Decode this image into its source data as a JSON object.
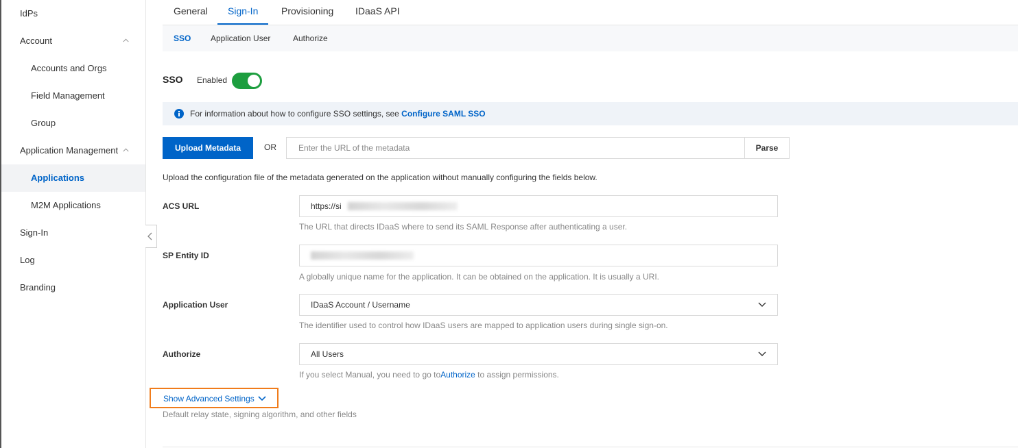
{
  "sidebar": {
    "items": [
      {
        "label": "IdPs"
      },
      {
        "label": "Account"
      },
      {
        "label": "Accounts and Orgs"
      },
      {
        "label": "Field Management"
      },
      {
        "label": "Group"
      },
      {
        "label": "Application Management"
      },
      {
        "label": "Applications"
      },
      {
        "label": "M2M Applications"
      },
      {
        "label": "Sign-In"
      },
      {
        "label": "Log"
      },
      {
        "label": "Branding"
      }
    ]
  },
  "tabs": [
    {
      "label": "General"
    },
    {
      "label": "Sign-In"
    },
    {
      "label": "Provisioning"
    },
    {
      "label": "IDaaS API"
    }
  ],
  "subtabs": [
    {
      "label": "SSO"
    },
    {
      "label": "Application User"
    },
    {
      "label": "Authorize"
    }
  ],
  "sso": {
    "title": "SSO",
    "enabled_label": "Enabled",
    "enabled": true
  },
  "info": {
    "text": "For information about how to configure SSO settings, see ",
    "link": "Configure SAML SSO"
  },
  "metadata": {
    "upload_label": "Upload Metadata",
    "or_label": "OR",
    "url_placeholder": "Enter the URL of the metadata",
    "parse_label": "Parse",
    "description": "Upload the configuration file of the metadata generated on the application without manually configuring the fields below."
  },
  "fields": {
    "acs_url": {
      "label": "ACS URL",
      "value_prefix": "https://si",
      "hint": "The URL that directs IDaaS where to send its SAML Response after authenticating a user."
    },
    "sp_entity_id": {
      "label": "SP Entity ID",
      "hint": "A globally unique name for the application. It can be obtained on the application. It is usually a URI."
    },
    "application_user": {
      "label": "Application User",
      "value": "IDaaS Account / Username",
      "hint": "The identifier used to control how IDaaS users are mapped to application users during single sign-on."
    },
    "authorize": {
      "label": "Authorize",
      "value": "All Users",
      "hint_prefix": "If you select Manual, you need to go to",
      "hint_link": "Authorize",
      "hint_suffix": " to assign permissions."
    }
  },
  "advanced": {
    "label": "Show Advanced Settings",
    "description": "Default relay state, signing algorithm, and other fields"
  },
  "colors": {
    "accent": "#0064c8",
    "toggle_on": "#1d9e3f",
    "highlight": "#f07c1b"
  }
}
